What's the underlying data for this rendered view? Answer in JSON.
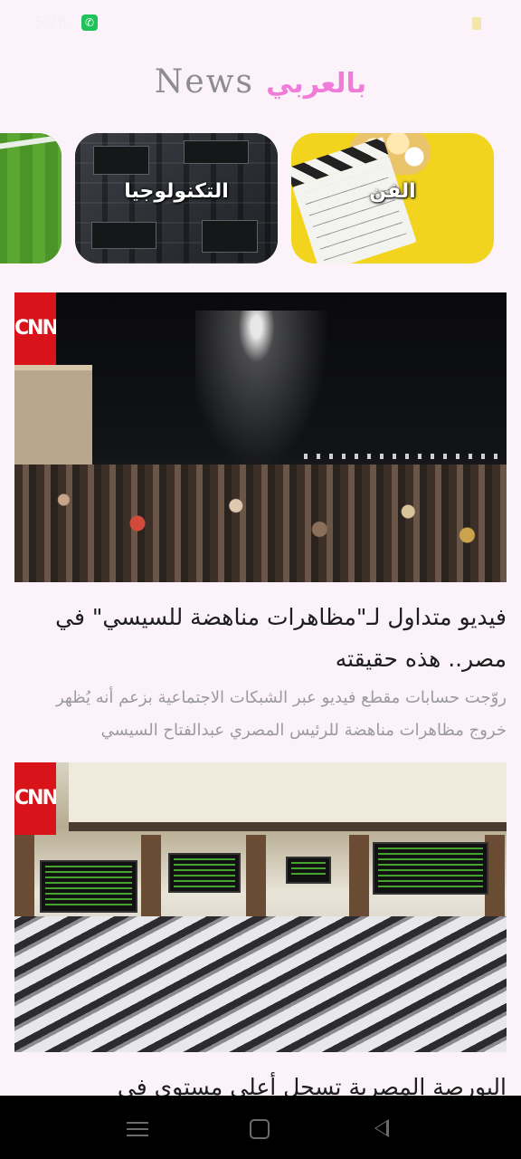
{
  "status_bar": {
    "time": "5:26",
    "app_icon": "whatsapp-icon",
    "right": "⚙ ✉ ◎ ⚡ ▮"
  },
  "header": {
    "title_en": "News",
    "title_ar": "بالعربي"
  },
  "categories": [
    {
      "label": "الفن",
      "icon": "clapperboard-image"
    },
    {
      "label": "التكنولوجيا",
      "icon": "circuit-board-image"
    },
    {
      "label": "",
      "icon": "grass-field-image"
    }
  ],
  "articles": [
    {
      "source_logo": "CNN",
      "headline": "فيديو متداول لـ\"مظاهرات مناهضة للسيسي\" في مصر.. هذه حقيقته",
      "summary": "روّجت حسابات مقطع فيديو عبر الشبكات الاجتماعية بزعم أنه يُظهر خروج مظاهرات مناهضة للرئيس المصري عبدالفتاح السيسي"
    },
    {
      "source_logo": "CNN",
      "headline": "البورصة المصرية تسجل أعلى مستوى في",
      "summary": ""
    }
  ],
  "nav": {
    "menu": "menu-icon",
    "home": "home-icon",
    "back": "back-icon"
  },
  "colors": {
    "background": "#fbf3f9",
    "accent_ar": "#f17bd8",
    "cnn_red": "#d8141a"
  }
}
